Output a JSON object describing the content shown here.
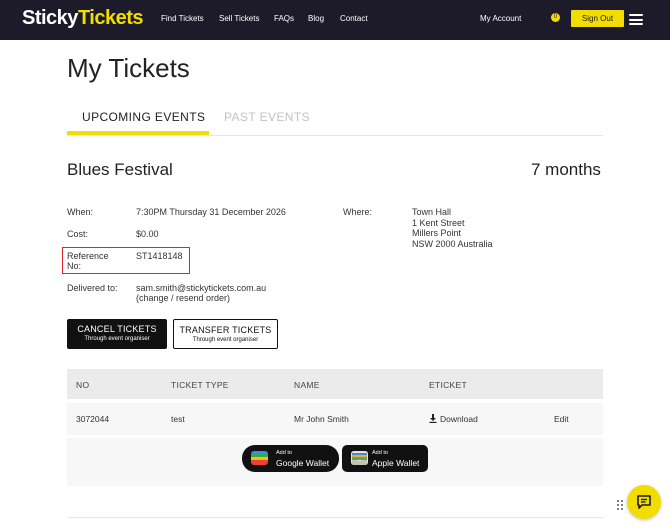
{
  "brand": {
    "part1": "Sticky",
    "part2": "Tickets",
    "yellow": "#f2dd00",
    "navy": "#1d1b2a"
  },
  "nav": {
    "find_tickets": "Find Tickets",
    "sell_tickets": "Sell Tickets",
    "faqs": "FAQs",
    "blog": "Blog",
    "contact": "Contact",
    "my_account": "My Account",
    "badge": "0",
    "sign_out": "Sign Out"
  },
  "page": {
    "title": "My Tickets"
  },
  "tabs": {
    "upcoming": "UPCOMING EVENTS",
    "past": "PAST EVENTS"
  },
  "event": {
    "title": "Blues Festival",
    "relative_time": "7 months",
    "when_label": "When:",
    "when_value": "7:30PM Thursday 31 December 2026",
    "cost_label": "Cost:",
    "cost_value": "$0.00",
    "reference_label_1": "Reference",
    "reference_label_2": "No:",
    "reference_value": "ST1418148",
    "delivered_label": "Delivered to:",
    "delivered_email": "sam.smith@stickytickets.com.au",
    "delivered_change": "(change / resend order)",
    "where_label": "Where:",
    "venue_lines": [
      "Town Hall",
      "1 Kent Street",
      "Millers Point",
      "NSW 2000 Australia"
    ]
  },
  "buttons": {
    "cancel_main": "CANCEL TICKETS",
    "cancel_sub": "Through event organiser",
    "transfer_main": "TRANSFER TICKETS",
    "transfer_sub": "Through event organiser"
  },
  "table": {
    "headers": [
      "NO",
      "TICKET TYPE",
      "NAME",
      "ETICKET"
    ],
    "rows": [
      {
        "no": "3072044",
        "type": "test",
        "name": "Mr John Smith",
        "eticket": "Download",
        "action": "Edit"
      }
    ]
  },
  "wallets": {
    "google_small": "Add to",
    "google_big": "Google Wallet",
    "apple_small": "Add to",
    "apple_big": "Apple Wallet"
  },
  "icons": [
    "hamburger-icon",
    "download-icon",
    "google-wallet-icon",
    "apple-wallet-icon",
    "drag-handle-icon",
    "chat-icon"
  ]
}
